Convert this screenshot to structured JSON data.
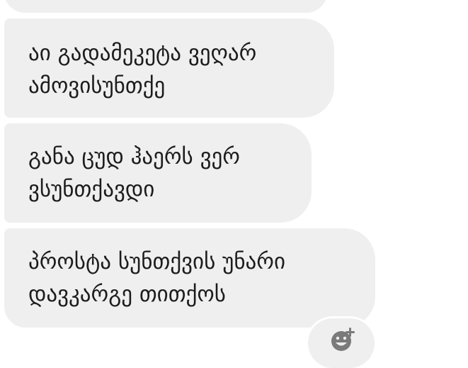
{
  "conversation": {
    "messages": [
      {
        "lines": []
      },
      {
        "lines": [
          "აი გადამეკეტა ვეღარ",
          "ამოვისუნთქე"
        ]
      },
      {
        "lines": [
          "განა ცუდ ჰაერს ვერ",
          "ვსუნთქავდი"
        ]
      },
      {
        "lines": [
          "პროსტა სუნთქვის უნარი",
          "დავკარგე თითქოს"
        ]
      }
    ],
    "reaction_button": {
      "icon": "add-reaction-icon"
    }
  },
  "colors": {
    "bubble_background": "#efefef",
    "text": "#1c1c1c",
    "icon": "#7a7a7a",
    "page_background": "#ffffff"
  }
}
